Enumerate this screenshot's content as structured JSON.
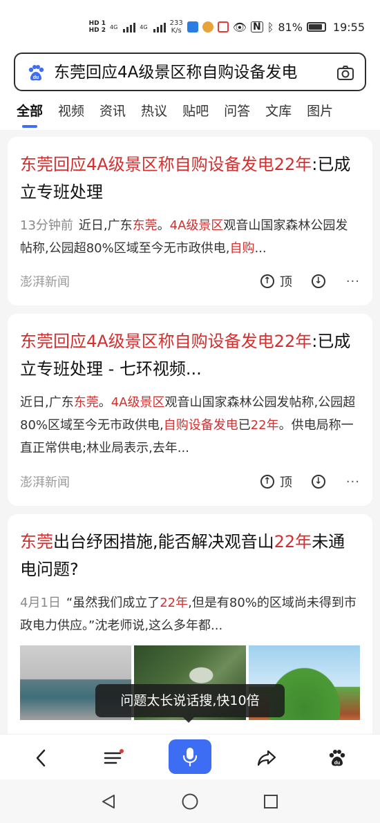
{
  "status_bar": {
    "hd_top": "HD 1",
    "hd_bottom": "HD 2",
    "net1": "4G",
    "net2": "4G",
    "speed_value": "233",
    "speed_unit": "K/s",
    "battery": "81%",
    "time": "19:55"
  },
  "search": {
    "query": "东莞回应4A级景区称自购设备发电"
  },
  "tabs": [
    "全部",
    "视频",
    "资讯",
    "热议",
    "贴吧",
    "问答",
    "文库",
    "图片"
  ],
  "results": [
    {
      "title_parts": [
        {
          "t": "东莞回应4A级景区称自购设备发电22年",
          "hl": true
        },
        {
          "t": ":已成立专班处理",
          "hl": false
        }
      ],
      "time": "13分钟前",
      "snippet_parts": [
        {
          "t": "近日,广东",
          "hl": false
        },
        {
          "t": "东莞",
          "hl": true
        },
        {
          "t": "。",
          "hl": false
        },
        {
          "t": "4A级景区",
          "hl": true
        },
        {
          "t": "观音山国家森林公园发帖称,公园超80%区域至今无市政供电,",
          "hl": false
        },
        {
          "t": "自购",
          "hl": true
        },
        {
          "t": "...",
          "hl": false
        }
      ],
      "source": "澎湃新闻",
      "top_label": "顶"
    },
    {
      "title_parts": [
        {
          "t": "东莞回应4A级景区称自购设备发电22年",
          "hl": true
        },
        {
          "t": ":已成立专班处理 - 七环视频...",
          "hl": false
        }
      ],
      "time": "",
      "snippet_parts": [
        {
          "t": "近日,广东",
          "hl": false
        },
        {
          "t": "东莞",
          "hl": true
        },
        {
          "t": "。",
          "hl": false
        },
        {
          "t": "4A级景区",
          "hl": true
        },
        {
          "t": "观音山国家森林公园发帖称,公园超80%区域至今无市政供电,",
          "hl": false
        },
        {
          "t": "自购设备发电",
          "hl": true
        },
        {
          "t": "已",
          "hl": false
        },
        {
          "t": "22年",
          "hl": true
        },
        {
          "t": "。供电局称一直正常供电;林业局表示,去年...",
          "hl": false
        }
      ],
      "source": "澎湃新闻",
      "top_label": "顶"
    },
    {
      "title_parts": [
        {
          "t": "东莞",
          "hl": true
        },
        {
          "t": "出台纾困措施,能否解决观音山",
          "hl": false
        },
        {
          "t": "22年",
          "hl": true
        },
        {
          "t": "未通电问题?",
          "hl": false
        }
      ],
      "time": "4月1日",
      "snippet_parts": [
        {
          "t": "“虽然我们成立了",
          "hl": false
        },
        {
          "t": "22年",
          "hl": true
        },
        {
          "t": ",但是有80%的区域尚未得到市政电力供应。”沈老师说,这么多年都...",
          "hl": false
        }
      ],
      "source": "",
      "top_label": ""
    }
  ],
  "toast": "问题太长说话搜,快10倍",
  "colors": {
    "highlight": "#d32f2f",
    "accent": "#3d6df2",
    "background": "#f5f5f6"
  },
  "icons": {
    "bottom_bar": [
      "back-icon",
      "menu-icon",
      "mic-icon",
      "share-icon",
      "baidu-paw-icon"
    ],
    "nav_bar": [
      "nav-back-icon",
      "nav-home-icon",
      "nav-recents-icon"
    ]
  }
}
